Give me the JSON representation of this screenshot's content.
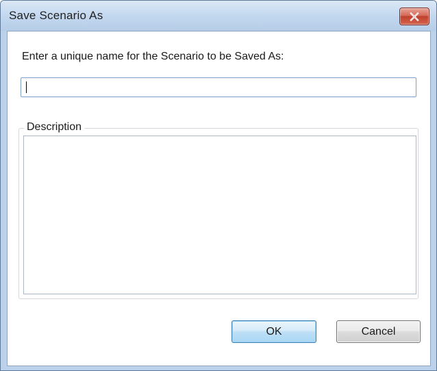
{
  "window": {
    "title": "Save Scenario As",
    "close_icon": "close-x-icon",
    "colors": {
      "title_bar": "#c3d8ef",
      "close_button": "#c0402e",
      "ok_button": "#bfe0f6"
    }
  },
  "form": {
    "prompt": "Enter a unique name for the Scenario to be Saved As:",
    "name_value": "",
    "description_label": "Description",
    "description_value": ""
  },
  "buttons": {
    "ok_label": "OK",
    "cancel_label": "Cancel"
  }
}
